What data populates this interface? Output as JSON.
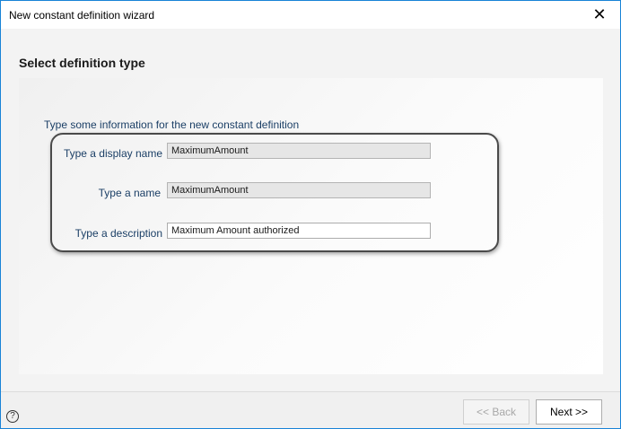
{
  "window": {
    "title": "New constant definition wizard",
    "close_icon": "close-icon"
  },
  "page": {
    "heading": "Select definition type",
    "instruction": "Type some information for the new constant definition"
  },
  "form": {
    "display_name": {
      "label": "Type a display name",
      "value": "MaximumAmount",
      "editable": false
    },
    "name": {
      "label": "Type a name",
      "value": "MaximumAmount",
      "editable": false
    },
    "description": {
      "label": "Type a description",
      "value": "Maximum Amount authorized",
      "editable": true
    }
  },
  "footer": {
    "help_icon": "help-icon",
    "help_glyph": "?",
    "back_label": "<< Back",
    "next_label": "Next >>"
  }
}
